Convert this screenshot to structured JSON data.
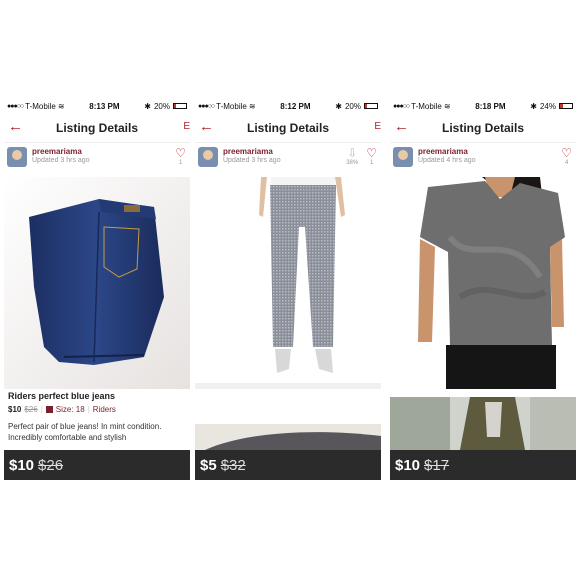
{
  "panels": [
    {
      "status": {
        "carrier": "T-Mobile",
        "time": "8:13 PM",
        "battery": "20%",
        "battery_level": 0.2
      },
      "nav": {
        "title": "Listing Details"
      },
      "seller": {
        "name": "preemariama",
        "updated": "Updated 3 hrs ago"
      },
      "likes": "1",
      "listing": {
        "title": "Riders perfect blue jeans",
        "price": "$10",
        "original_price": "$26",
        "size": "Size: 18",
        "brand": "Riders",
        "description": "Perfect pair of blue jeans! In mint condition. Incredibly comfortable and stylish"
      },
      "pricebar": {
        "price": "$10",
        "original": "$26"
      }
    },
    {
      "status": {
        "carrier": "T-Mobile",
        "time": "8:12 PM",
        "battery": "20%",
        "battery_level": 0.2
      },
      "nav": {
        "title": "Listing Details"
      },
      "seller": {
        "name": "preemariama",
        "updated": "Updated 3 hrs ago"
      },
      "price_drop": "38%",
      "likes": "1",
      "pricebar": {
        "price": "$5",
        "original": "$32"
      }
    },
    {
      "status": {
        "carrier": "T-Mobile",
        "time": "8:18 PM",
        "battery": "24%",
        "battery_level": 0.24
      },
      "nav": {
        "title": "Listing Details"
      },
      "seller": {
        "name": "preemariama",
        "updated": "Updated 4 hrs ago"
      },
      "likes": "4",
      "pricebar": {
        "price": "$10",
        "original": "$17"
      }
    }
  ],
  "colors": {
    "accent": "#b5202e",
    "seller_name": "#7a1f2b",
    "price_bar": "#2b2b2b"
  }
}
